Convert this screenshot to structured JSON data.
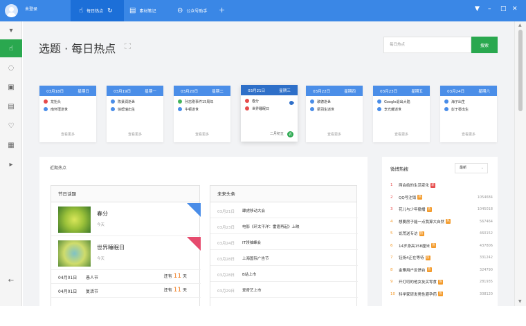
{
  "topbar": {
    "login": "未登录",
    "tabs": [
      {
        "icon": "hand-icon",
        "label": "每日热点"
      },
      {
        "icon": "notebook-icon",
        "label": "素材笔记"
      },
      {
        "icon": "assistant-icon",
        "label": "公众号助手"
      }
    ],
    "add_tab": "+",
    "window": {
      "menu": "▼",
      "minimize": "–",
      "maximize": "□",
      "close": "✕"
    }
  },
  "sidebar": {
    "items": [
      {
        "icon": "collapse-arrow-icon",
        "glyph": "▾"
      },
      {
        "icon": "hand-pointer-icon",
        "glyph": "☝"
      },
      {
        "icon": "chat-bubble-icon",
        "glyph": "◌"
      },
      {
        "icon": "calendar-icon",
        "glyph": "▣"
      },
      {
        "icon": "document-icon",
        "glyph": "▤"
      },
      {
        "icon": "thumb-up-icon",
        "glyph": "♡"
      },
      {
        "icon": "search-doc-icon",
        "glyph": "▦"
      },
      {
        "icon": "expand-arrow-icon",
        "glyph": "▸"
      },
      {
        "icon": "back-arrow-icon",
        "glyph": "←"
      }
    ]
  },
  "page": {
    "title": "选题 · 每日热点",
    "search_placeholder": "每日热点",
    "search_button": "搜索"
  },
  "days": [
    {
      "date": "03月18日",
      "weekday": "星期日",
      "items": [
        {
          "color": "red",
          "text": "龙抬头"
        },
        {
          "color": "blue",
          "text": "南怀瑾逝世"
        }
      ],
      "more": "查看更多"
    },
    {
      "date": "03月19日",
      "weekday": "星期一",
      "items": [
        {
          "color": "blue",
          "text": "陈景润逝世"
        },
        {
          "color": "blue",
          "text": "徐帮瑞出生"
        }
      ],
      "more": "查看更多"
    },
    {
      "date": "03月20日",
      "weekday": "星期二",
      "items": [
        {
          "color": "green",
          "text": "孙志刚事件15周年"
        },
        {
          "color": "blue",
          "text": "牛顿逝世"
        }
      ],
      "more": "查看更多"
    },
    {
      "date": "03月21日",
      "weekday": "星期三",
      "items": [
        {
          "color": "red",
          "text": "春分"
        },
        {
          "color": "red",
          "text": "世界睡眠日"
        }
      ],
      "lunar": "二月初五",
      "lunar_icon": "农"
    },
    {
      "date": "03月22日",
      "weekday": "星期四",
      "items": [
        {
          "color": "blue",
          "text": "歌德逝世"
        },
        {
          "color": "blue",
          "text": "梁羽生逝世"
        }
      ],
      "more": "查看更多"
    },
    {
      "date": "03月23日",
      "weekday": "星期五",
      "items": [
        {
          "color": "blue",
          "text": "Google退出大陆"
        },
        {
          "color": "blue",
          "text": "李光耀逝世"
        }
      ],
      "more": "查看更多"
    },
    {
      "date": "03月24日",
      "weekday": "星期六",
      "items": [
        {
          "color": "blue",
          "text": "海子出生"
        },
        {
          "color": "blue",
          "text": "彭于晏出生"
        }
      ],
      "more": "查看更多"
    }
  ],
  "recent": {
    "title": "近期热点",
    "festivals": {
      "header": "节日话题",
      "featured": [
        {
          "name": "春分",
          "day": "今天",
          "ribbon": "blue"
        },
        {
          "name": "世界睡眠日",
          "day": "今天",
          "ribbon": "red"
        }
      ],
      "list": [
        {
          "date": "04月01日",
          "name": "愚人节",
          "prefix": "还有",
          "count": "11",
          "suffix": "天"
        },
        {
          "date": "04月01日",
          "name": "复活节",
          "prefix": "还有",
          "count": "11",
          "suffix": "天"
        }
      ]
    },
    "headlines": {
      "header": "未来头条",
      "rows": [
        {
          "date": "03月21日",
          "text": "肆虎移动大会"
        },
        {
          "date": "03月23日",
          "text": "电影《环太平洋：雷霆再起》上映"
        },
        {
          "date": "03月24日",
          "text": "IT领袖峰会"
        },
        {
          "date": "03月28日",
          "text": "上海国际广告节"
        },
        {
          "date": "03月28日",
          "text": "B站上市"
        },
        {
          "date": "03月29日",
          "text": "爱奇艺上市"
        }
      ]
    }
  },
  "weibo": {
    "title": "微博热搜",
    "select": "最新",
    "rows": [
      {
        "rank": "1",
        "text": "两会给的生活变化",
        "badge": "新",
        "badge_color": "red",
        "heat": ""
      },
      {
        "rank": "2",
        "text": "QQ号注销",
        "badge": "热",
        "badge_color": "orange",
        "heat": "1054684"
      },
      {
        "rank": "3",
        "text": "花儿与少年撤播",
        "badge": "热",
        "badge_color": "orange",
        "heat": "1045018"
      },
      {
        "rank": "4",
        "text": "想要房子能一点我算大自然",
        "badge": "热",
        "badge_color": "orange",
        "heat": "567464"
      },
      {
        "rank": "5",
        "text": "饥荒送专访",
        "badge": "热",
        "badge_color": "orange",
        "heat": "460152"
      },
      {
        "rank": "6",
        "text": "14岁身高158厘米",
        "badge": "热",
        "badge_color": "orange",
        "heat": "437806"
      },
      {
        "rank": "7",
        "text": "钰炀4正在等待",
        "badge": "热",
        "badge_color": "orange",
        "heat": "331242"
      },
      {
        "rank": "8",
        "text": "金寨用户反馈台",
        "badge": "热",
        "badge_color": "orange",
        "heat": "324790"
      },
      {
        "rank": "9",
        "text": "开灯叨的他女友买零食",
        "badge": "热",
        "badge_color": "orange",
        "heat": "281935"
      },
      {
        "rank": "10",
        "text": "科学家研发男性避孕药",
        "badge": "热",
        "badge_color": "orange",
        "heat": "308120"
      }
    ]
  },
  "colors": {
    "accent": "#3a87e6",
    "active_tab": "#1c6fd8",
    "green": "#2aa84f",
    "red": "#e64b4b",
    "orange": "#f39a2a"
  }
}
